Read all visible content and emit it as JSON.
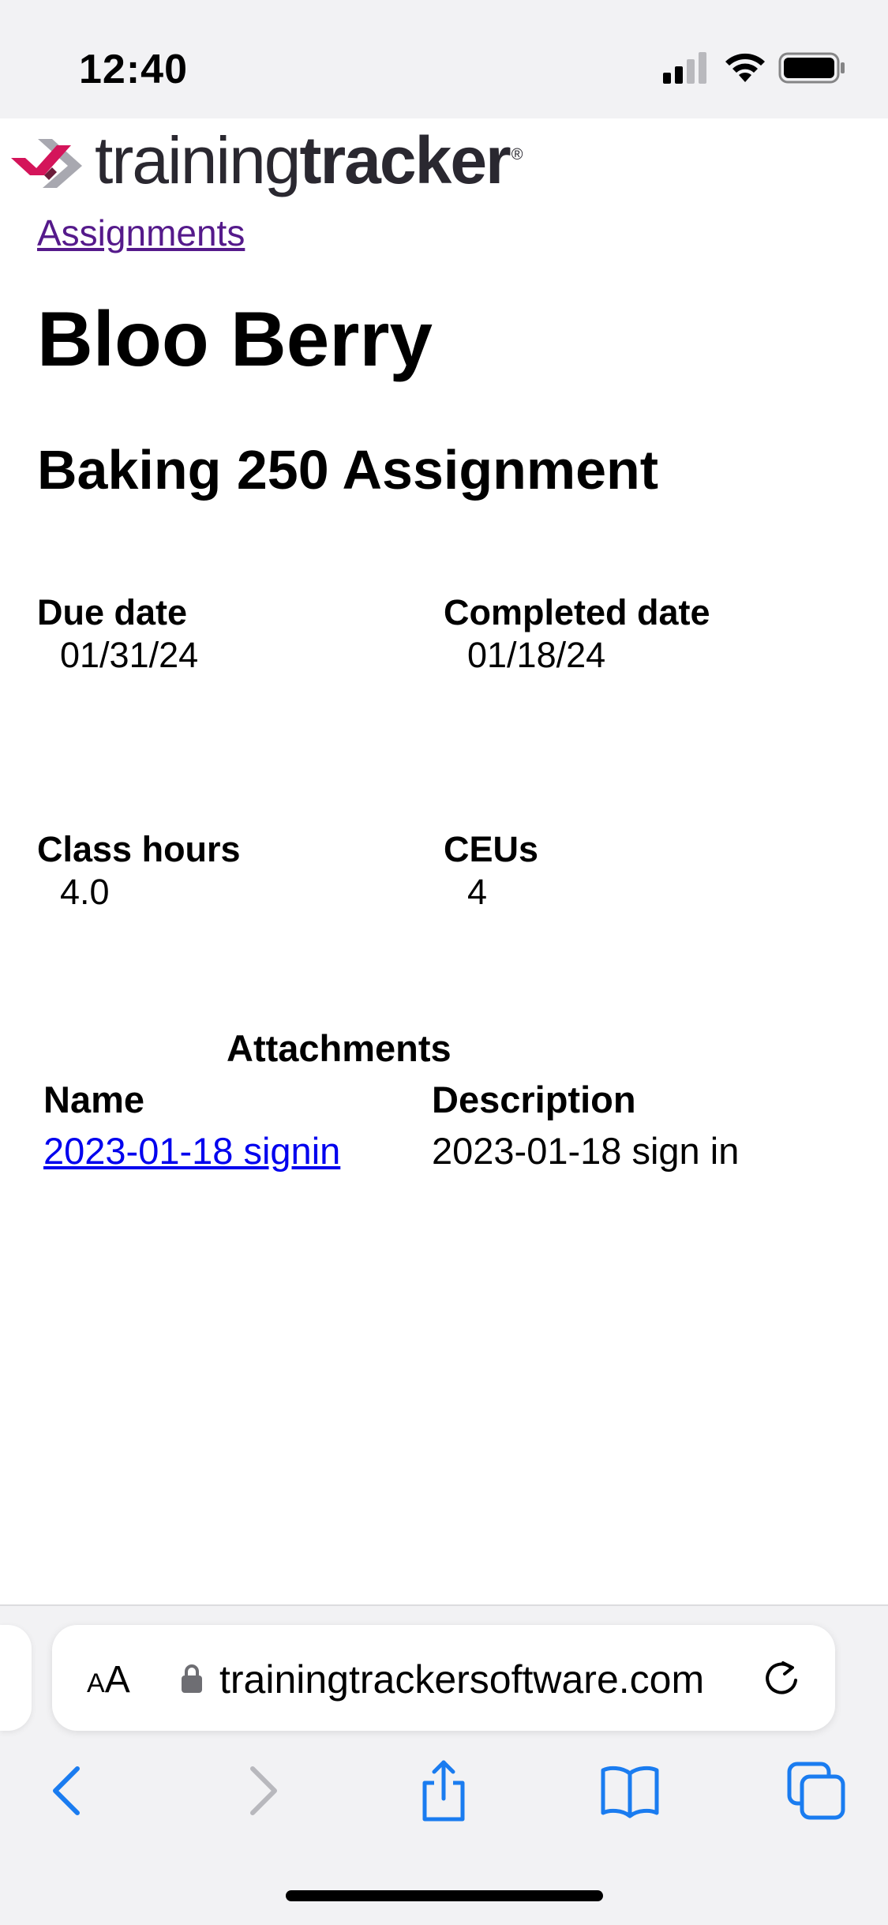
{
  "status": {
    "time": "12:40"
  },
  "logo": {
    "text_light": "training",
    "text_bold": "tracker",
    "registered": "®"
  },
  "breadcrumb": "Assignments",
  "person_name": "Bloo Berry",
  "assignment_title": "Baking 250 Assignment",
  "fields": {
    "due_date": {
      "label": "Due date",
      "value": "01/31/24"
    },
    "completed_date": {
      "label": "Completed date",
      "value": "01/18/24"
    },
    "class_hours": {
      "label": "Class hours",
      "value": "4.0"
    },
    "ceus": {
      "label": "CEUs",
      "value": "4"
    }
  },
  "attachments": {
    "title": "Attachments",
    "columns": {
      "name": "Name",
      "description": "Description"
    },
    "rows": [
      {
        "name": "2023-01-18 signin",
        "description": "2023-01-18 sign in"
      }
    ]
  },
  "browser": {
    "aa_label_small": "A",
    "aa_label_large": "A",
    "url": "trainingtrackersoftware.com",
    "accent_color": "#1a7cf0",
    "disabled_color": "#b8b8bd"
  }
}
